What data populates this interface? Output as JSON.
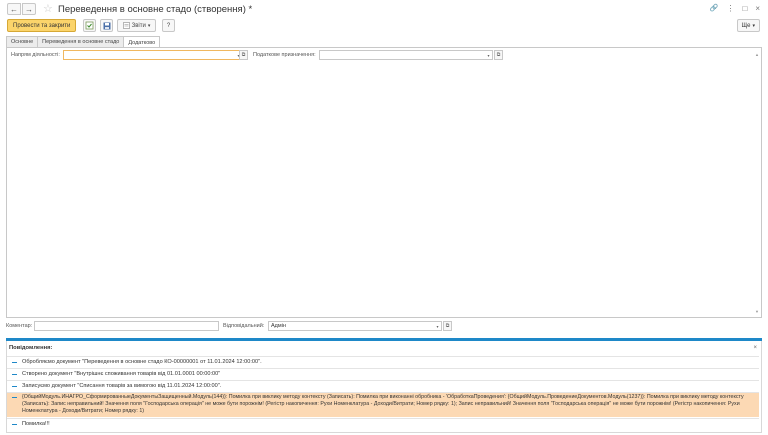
{
  "window": {
    "title": "Переведення в основне стадо  (створення) *",
    "nav_back": "←",
    "nav_forward": "→",
    "star": "☆",
    "link_icon": "🔗",
    "menu_icon": "⋮",
    "maximize_icon": "□",
    "close_icon": "×"
  },
  "toolbar": {
    "post_close_label": "Провести та закрити",
    "reports_label": "Звіти",
    "help_label": "?",
    "more_label": "Ще",
    "dropdown_arrow": "▾"
  },
  "tabs": [
    {
      "label": "Основне",
      "active": false
    },
    {
      "label": "Переведення в основне стадо",
      "active": false
    },
    {
      "label": "Додатково",
      "active": true
    }
  ],
  "fields": {
    "activity_direction": {
      "label": "Напрям діяльності:",
      "value": ""
    },
    "tax_purpose": {
      "label": "Податкове призначення:",
      "value": ""
    },
    "comment": {
      "label": "Коментар:",
      "value": ""
    },
    "responsible": {
      "label": "Відповідальний:",
      "value": "Адмін"
    }
  },
  "messages": {
    "header": "Повідомлення:",
    "close": "×",
    "items": [
      {
        "text": "Обробляємо документ \"Переведення в основне стадо  КО-00000001 от 11.01.2024 12:00:00\".",
        "type": "info"
      },
      {
        "text": "Створено документ \"Внутрішнє споживання товарів  від 01.01.0001 00:00:00\"",
        "type": "info"
      },
      {
        "text": "Записуємо документ \"Списання товарів за вимогою              від 11.01.2024 12:00:00\".",
        "type": "info"
      },
      {
        "text": "{ОбщийМодуль.ИНАГРО_СформированныеДокументыЗащищенный.Модуль(144)}: Помилка при виклику методу контексту (Записать): Помилка при виконанні обробника - 'ОбработкаПроведения': {ОбщийМодуль.ПроведениеДокументов.Модуль(1237)}: Помилка при виклику методу контексту (Записать): Запис неправильний! Значення поля \"Господарська операція\" не може бути порожнім! (Регістр накопичення: Рухи Номенклатура - Доходи/Витрати; Номер рядку: 1); Запис неправильний! Значення поля \"Господарська операція\" не може бути порожнім! (Регістр накопичення: Рухи Номенклатура - Доходи/Витрати; Номер рядку: 1)",
        "type": "error"
      },
      {
        "text": "Помилка!!!",
        "type": "info"
      }
    ]
  },
  "colors": {
    "primary_button": "#fbd46b",
    "accent_blue": "#1e88c8",
    "error_row": "#fcd9b4",
    "focus_border": "#f0b860"
  }
}
